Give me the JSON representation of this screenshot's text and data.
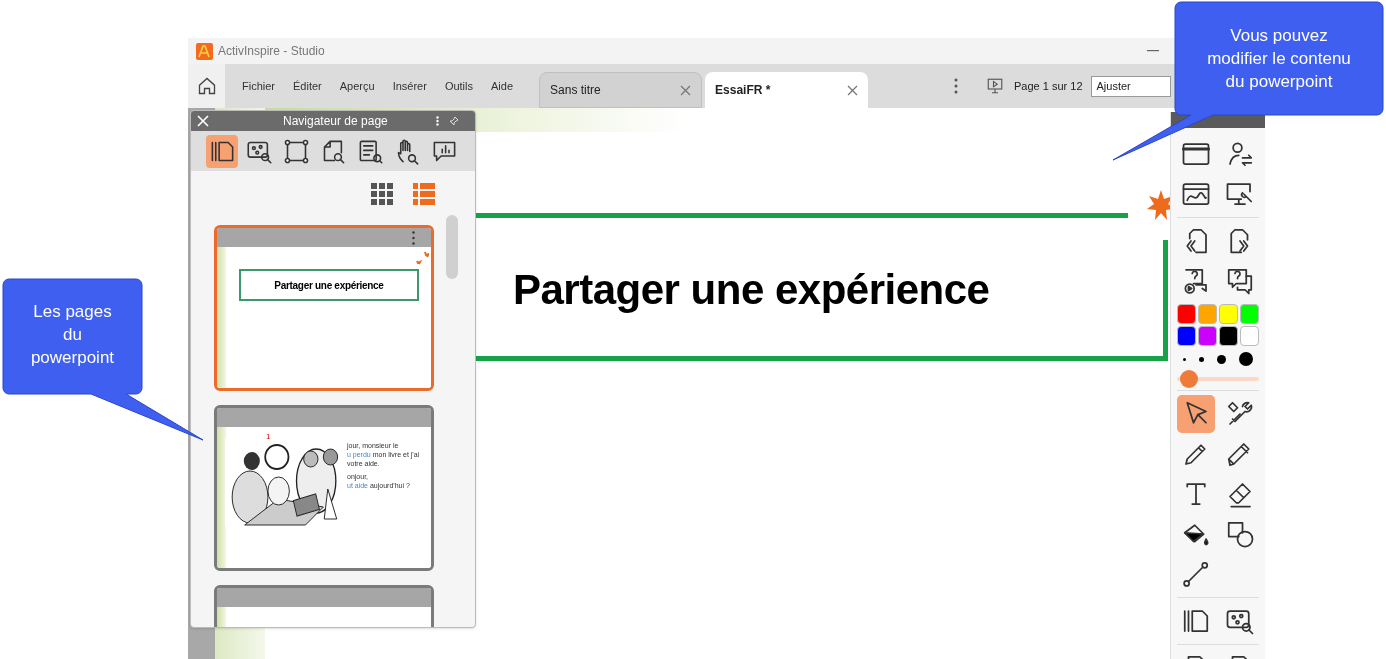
{
  "window": {
    "title": "ActivInspire - Studio"
  },
  "menu": [
    "Fichier",
    "Éditer",
    "Aperçu",
    "Insérer",
    "Outils",
    "Aide"
  ],
  "tabs": [
    {
      "label": "Sans titre",
      "selected": false
    },
    {
      "label": "EssaiFR *",
      "selected": true
    }
  ],
  "page_indicator": "Page 1 sur 12",
  "zoom_field": {
    "value": "Ajuster"
  },
  "slide": {
    "title": "Partager une expérience"
  },
  "navigator": {
    "title": "Navigateur de page",
    "tools": [
      {
        "kind": "pages",
        "selected": true
      },
      {
        "kind": "objects",
        "selected": false
      },
      {
        "kind": "frame",
        "selected": false
      },
      {
        "kind": "pagesearch",
        "selected": false
      },
      {
        "kind": "notes",
        "selected": false
      },
      {
        "kind": "hand",
        "selected": false
      },
      {
        "kind": "chart",
        "selected": false
      }
    ],
    "view_modes": [
      {
        "kind": "grid",
        "selected": false
      },
      {
        "kind": "list",
        "selected": true
      }
    ],
    "pages": [
      {
        "kind": "title",
        "selected": true,
        "title": "Partager une expérience"
      },
      {
        "kind": "dialogue",
        "selected": false,
        "marker": "1",
        "lines": [
          {
            "text": "jour, monsieur le"
          },
          {
            "accent": "u perdu",
            "text": "mon livre et j'ai"
          },
          {
            "text": "votre aide."
          },
          {
            "text": "onjour,"
          },
          {
            "accent": "ut aide",
            "text": "aujourd'hui ?"
          }
        ]
      },
      {
        "kind": "blank",
        "selected": false
      }
    ]
  },
  "toolbox": {
    "sections": [
      [
        {
          "kind": "window",
          "selected": false
        },
        {
          "kind": "user",
          "selected": false
        },
        {
          "kind": "web",
          "selected": false
        },
        {
          "kind": "monitor",
          "selected": false
        }
      ],
      [
        {
          "kind": "prev",
          "selected": false
        },
        {
          "kind": "next",
          "selected": false
        },
        {
          "kind": "qvideo",
          "selected": false
        },
        {
          "kind": "question",
          "selected": false
        }
      ],
      [
        {
          "kind": "pointer",
          "selected": true
        },
        {
          "kind": "tools",
          "selected": false
        },
        {
          "kind": "pen",
          "selected": false
        },
        {
          "kind": "highlighter",
          "selected": false
        },
        {
          "kind": "text",
          "selected": false
        },
        {
          "kind": "eraser",
          "selected": false
        },
        {
          "kind": "fill",
          "selected": false
        },
        {
          "kind": "shapes",
          "selected": false
        },
        {
          "kind": "connector",
          "selected": false
        }
      ],
      [
        {
          "kind": "pages",
          "selected": false
        },
        {
          "kind": "objects",
          "selected": false
        }
      ],
      [
        {
          "kind": "pagedelete",
          "selected": false
        },
        {
          "kind": "pagereset",
          "selected": false
        }
      ]
    ],
    "colors": [
      {
        "color": "#ff0000"
      },
      {
        "color": "#ffa500"
      },
      {
        "color": "#ffff00"
      },
      {
        "color": "#00ff00"
      },
      {
        "color": "#0000ff"
      },
      {
        "color": "#cc00ff"
      },
      {
        "color": "#000000"
      },
      {
        "color": "#ffffff"
      }
    ],
    "width_slider": {
      "level": 0.04
    }
  },
  "callouts": [
    {
      "lines": [
        "Les pages",
        "du",
        "powerpoint"
      ]
    },
    {
      "lines": [
        "Vous pouvez",
        "modifier le contenu",
        "du powerpoint"
      ]
    }
  ]
}
